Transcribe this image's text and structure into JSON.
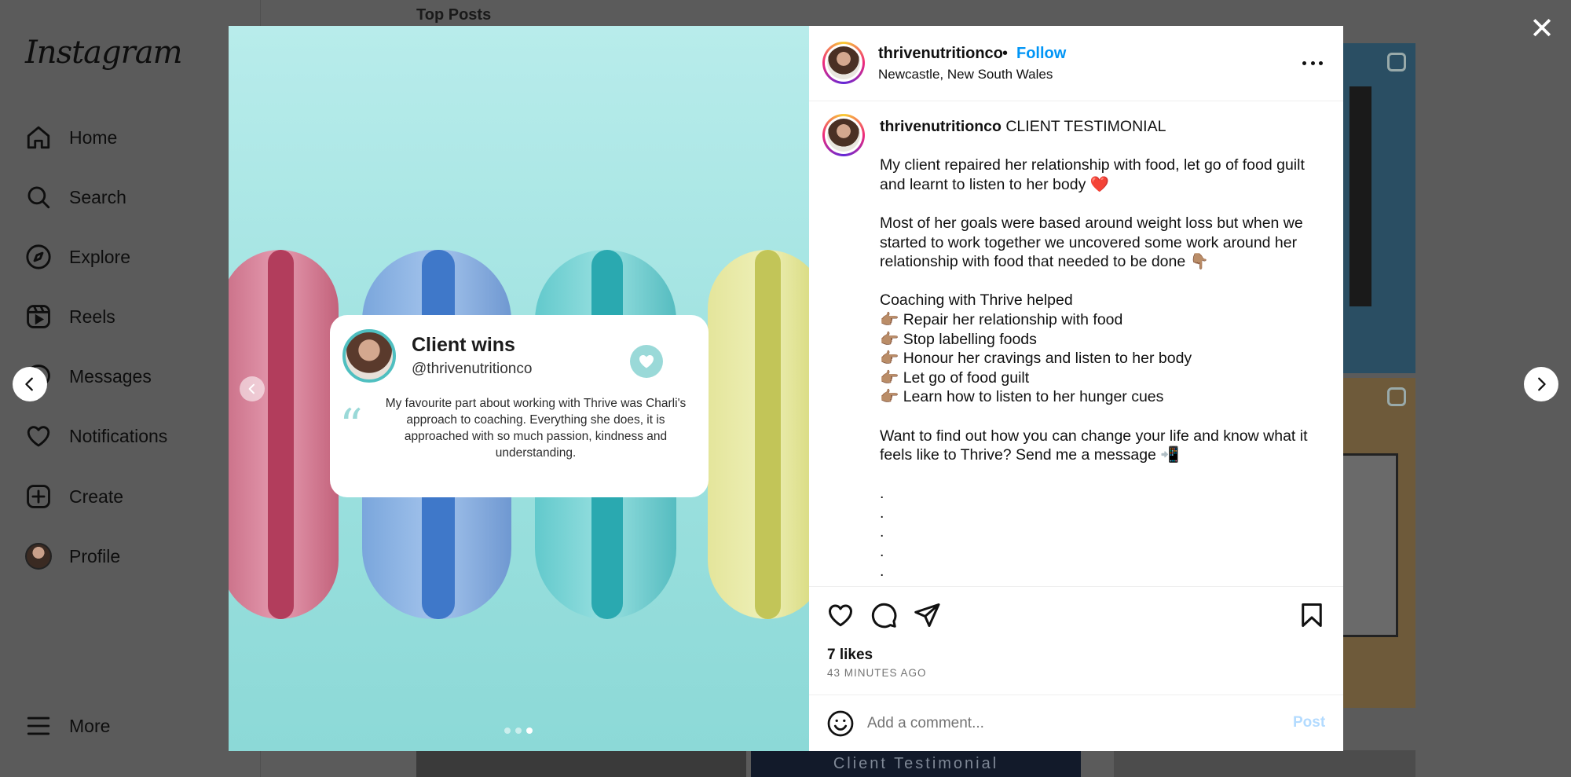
{
  "app": {
    "logo": "Instagram"
  },
  "sidebar": {
    "items": [
      {
        "label": "Home",
        "icon": "home-icon"
      },
      {
        "label": "Search",
        "icon": "search-icon"
      },
      {
        "label": "Explore",
        "icon": "compass-icon"
      },
      {
        "label": "Reels",
        "icon": "reels-icon"
      },
      {
        "label": "Messages",
        "icon": "messenger-icon"
      },
      {
        "label": "Notifications",
        "icon": "heart-icon"
      },
      {
        "label": "Create",
        "icon": "plus-square-icon"
      },
      {
        "label": "Profile",
        "icon": "avatar"
      }
    ],
    "more_label": "More"
  },
  "background": {
    "section_title": "Top Posts",
    "tile_caption": "Client Testimonial"
  },
  "post": {
    "username": "thrivenutritionco",
    "separator": "•",
    "follow_label": "Follow",
    "location": "Newcastle, New South Wales",
    "caption_headline": "CLIENT TESTIMONIAL",
    "caption_body": "My client repaired her relationship with food, let go of food guilt and learnt to listen to her body ❤️\n\nMost of her goals were based around weight loss but when we started to work together we uncovered some work around her relationship with food that needed to be done 👇🏽\n\nCoaching with Thrive helped\n👉🏽 Repair her relationship with food\n👉🏽 Stop labelling foods\n👉🏽 Honour her cravings and listen to her body\n👉🏽 Let go of food guilt\n👉🏽 Learn how to listen to her hunger cues\n\nWant to find out how you can change your life and know what it feels like to Thrive? Send me a message 📲\n\n.\n.\n.\n.\n.",
    "likes": "7 likes",
    "time_ago": "43 MINUTES AGO",
    "comment_placeholder": "Add a comment...",
    "post_label": "Post",
    "carousel": {
      "count": 3,
      "active_index": 2
    }
  },
  "media_card": {
    "title": "Client wins",
    "handle": "@thrivenutritionco",
    "quote": "My favourite part about working with Thrive was Charli's approach to coaching. Everything she does, it is approached with so much passion, kindness and understanding."
  },
  "colors": {
    "accent": "#0095f6",
    "post_disabled": "#b3dbff",
    "overlay": "#5b5b5b",
    "card_teal": "#4fbfc0"
  }
}
